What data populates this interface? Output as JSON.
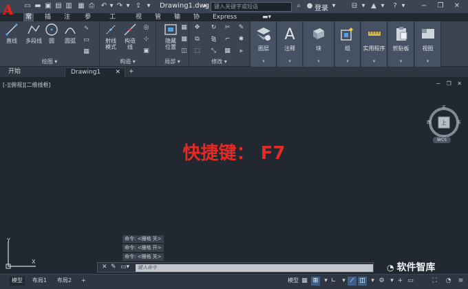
{
  "app": {
    "logo_letter": "A",
    "document_title": "Drawing1.dwg",
    "search_placeholder": "键入关键字或短语",
    "login_label": "登录"
  },
  "menu_tabs": [
    "常用",
    "插入",
    "注释",
    "参数化",
    "视图",
    "管理",
    "输出",
    "协作",
    "Express Tools"
  ],
  "menu_tabs_extra": [
    "工具集"
  ],
  "ribbon": {
    "draw_panel": {
      "title": "绘图",
      "tools": [
        "直线",
        "多段线",
        "圆",
        "圆弧"
      ]
    },
    "construct_panel": {
      "title": "构造",
      "tools": [
        "射线\n模式",
        "构造\n线"
      ]
    },
    "hatch_tool": "隐藏\n位置",
    "layer_panel_title": "局部",
    "modify_panel_title": "修改",
    "big_buttons": [
      "图层",
      "注释",
      "块",
      "组",
      "实用程序",
      "剪贴板",
      "视图"
    ]
  },
  "file_tabs": [
    "开始",
    "Drawing1"
  ],
  "viewport": {
    "label": "[-][俯视][二维线框]",
    "hotkey_text": "快捷键： F7",
    "viewcube": {
      "north": "北",
      "south": "南",
      "east": "东",
      "west": "西",
      "face": "上",
      "wcs": "WCS"
    },
    "ucs_y": "Y",
    "ucs_x": "X"
  },
  "command": {
    "history": [
      "命令: <栅格 关>",
      "命令: <栅格 开>",
      "命令: <栅格 关>"
    ],
    "placeholder": "键入命令"
  },
  "watermark": "软件智库",
  "status": {
    "layout_tabs": [
      "模型",
      "布局1",
      "布局2"
    ],
    "model_label": "模型",
    "add_tab": "+"
  }
}
